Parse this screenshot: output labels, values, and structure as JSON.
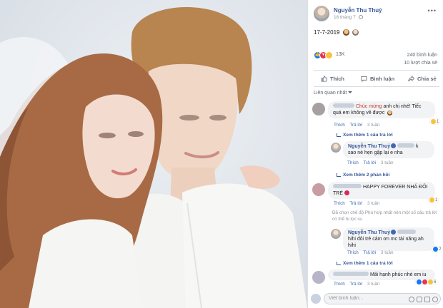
{
  "post": {
    "author": "Nguyễn Thu Thuỷ",
    "date": "16 tháng 7",
    "caption": "17-7-2019",
    "reaction_count": "13K",
    "comments_count": "240 bình luận",
    "shares_count": "10 lượt chia sẻ"
  },
  "actions": {
    "like": "Thích",
    "comment": "Bình luận",
    "share": "Chia sẻ"
  },
  "sort_label": "Liên quan nhất",
  "comments": [
    {
      "highlight": "Chúc mừng",
      "text_a": "anh chị nhé! Tiếc",
      "text_b": "quá em không về được",
      "like": "Thích",
      "reply": "Trả lời",
      "time": "3 tuần",
      "reactions": "1",
      "more_replies": "Xem thêm 1 câu trả lời"
    },
    {
      "author": "Nguyễn Thu Thuỷ",
      "suffix": "k",
      "text": "sao nè hẹn gặp lại e nha",
      "like": "Thích",
      "reply": "Trả lời",
      "time": "3 tuần",
      "more_replies": "Xem thêm 2 phản hồi"
    },
    {
      "text_a": "HAPPY FOREVER NHÁ ĐÔI",
      "text_b": "TRẺ",
      "like": "Thích",
      "reply": "Trả lời",
      "time": "3 tuần",
      "reactions": "1",
      "filter_note": "Đã chọn chế độ Phù hợp nhất nên một số câu trả lời có thể bị lọc ra."
    },
    {
      "author": "Nguyễn Thu Thuỷ",
      "text_a": "hihi đôi trẻ cảm ơn mc tài năng ah",
      "text_b": "hihi",
      "like": "Thích",
      "reply": "Trả lời",
      "time": "3 tuần",
      "reactions": "2",
      "more_replies": "Xem thêm 1 câu trả lời"
    },
    {
      "text": "Mãi hạnh phúc nhé em iu",
      "like": "Thích",
      "reply": "Trả lời",
      "time": "3 tuần",
      "reactions": "6"
    }
  ],
  "composer": {
    "placeholder": "Viết bình luận..."
  },
  "colors": {
    "link": "#365899",
    "accent": "#4267b2",
    "muted": "#90949c"
  }
}
